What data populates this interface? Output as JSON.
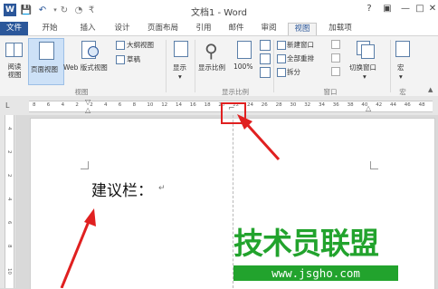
{
  "window": {
    "title": "文档1 - Word",
    "help": "?",
    "minimize": "—",
    "restore": "□",
    "close": "✕"
  },
  "qat": {
    "save": "💾",
    "undo": "↶",
    "redo": "↻",
    "customize": "₹"
  },
  "tabs": [
    "文件",
    "开始",
    "插入",
    "设计",
    "页面布局",
    "引用",
    "邮件",
    "审阅",
    "视图",
    "加载项"
  ],
  "ribbon": {
    "views": {
      "read_mode": "阅读视图",
      "print_layout": "页面视图",
      "web_layout": "Web 版式视图",
      "outline": "大纲视图",
      "draft": "草稿",
      "group_label": "视图"
    },
    "show": {
      "label": "显示"
    },
    "zoom": {
      "zoom_label": "显示比例",
      "hundred": "100%",
      "group_label": "显示比例"
    },
    "window": {
      "new_window": "新建窗口",
      "arrange_all": "全部重排",
      "split": "拆分",
      "switch_windows": "切换窗口",
      "group_label": "窗口"
    },
    "macros": {
      "label": "宏",
      "group_label": "宏"
    }
  },
  "ruler": {
    "corner": "L",
    "ticks": [
      "8",
      "6",
      "4",
      "2",
      "2",
      "4",
      "6",
      "8",
      "10",
      "12",
      "14",
      "16",
      "18",
      "20",
      "22",
      "24",
      "26",
      "28",
      "30",
      "32",
      "34",
      "36",
      "38",
      "40",
      "42",
      "44",
      "46",
      "48"
    ],
    "vticks": [
      "4",
      "2",
      "2",
      "4",
      "6",
      "8",
      "10"
    ]
  },
  "document": {
    "text": "建议栏：",
    "para_mark": "↵"
  },
  "watermark": {
    "title": "技术员联盟",
    "url": "www.jsgho.com"
  },
  "annotation_color": "#e02020"
}
